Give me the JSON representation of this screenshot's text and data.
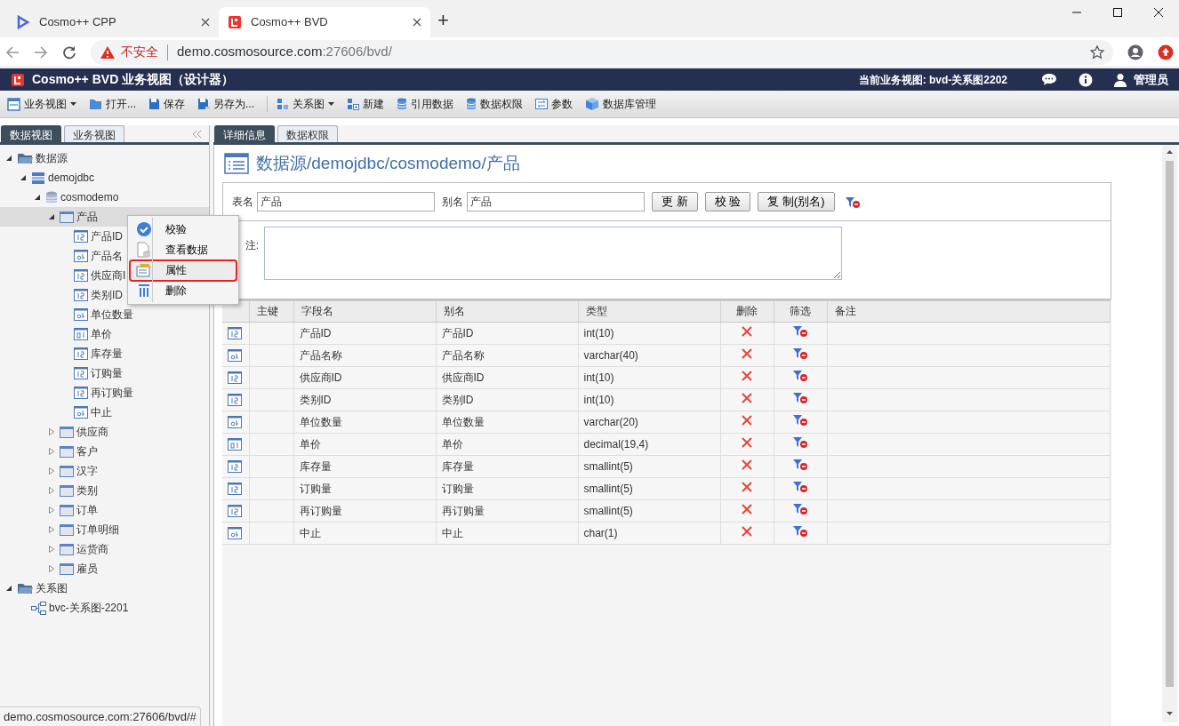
{
  "browser": {
    "tabs": [
      {
        "title": "Cosmo++ CPP",
        "kind": "cpp",
        "selected": false
      },
      {
        "title": "Cosmo++ BVD",
        "kind": "bvd",
        "selected": true
      }
    ],
    "new_tab": "+",
    "address": {
      "warning": "不安全",
      "host": "demo.cosmosource.com",
      "path": ":27606/bvd/"
    }
  },
  "app_header": {
    "title": "Cosmo++ BVD 业务视图（设计器）",
    "current_view": "当前业务视图: bvd-关系图2202",
    "user": "管理员"
  },
  "toolbar": [
    [
      {
        "label": "业务视图",
        "kind": "view",
        "dropdown": true
      },
      {
        "label": "打开...",
        "kind": "open",
        "dropdown": false
      },
      {
        "label": "保存",
        "kind": "save",
        "dropdown": false
      },
      {
        "label": "另存为...",
        "kind": "saveas",
        "dropdown": false
      }
    ],
    [
      {
        "label": "关系图",
        "kind": "diagram",
        "dropdown": true
      },
      {
        "label": "新建",
        "kind": "new",
        "dropdown": false
      },
      {
        "label": "引用数据",
        "kind": "database",
        "dropdown": false
      },
      {
        "label": "数据权限",
        "kind": "database",
        "dropdown": false
      },
      {
        "label": "参数",
        "kind": "params",
        "dropdown": false
      },
      {
        "label": "数据库管理",
        "kind": "cube",
        "dropdown": false
      }
    ]
  ],
  "left_panel": {
    "tabs": [
      {
        "label": "数据视图",
        "selected": true
      },
      {
        "label": "业务视图",
        "selected": false
      }
    ],
    "tree": [
      {
        "label": "数据源",
        "kind": "folder",
        "expanded": true,
        "selected": false,
        "children": [
          {
            "label": "demojdbc",
            "kind": "server",
            "expanded": true,
            "selected": false,
            "children": [
              {
                "label": "cosmodemo",
                "kind": "database",
                "expanded": true,
                "selected": false,
                "children": [
                  {
                    "label": "产品",
                    "kind": "table",
                    "expanded": true,
                    "selected": true,
                    "children": [
                      {
                        "label": "产品ID",
                        "kind": "field-int",
                        "selected": false
                      },
                      {
                        "label": "产品名",
                        "kind": "field-text",
                        "selected": false
                      },
                      {
                        "label": "供应商I",
                        "kind": "field-int",
                        "selected": false
                      },
                      {
                        "label": "类别ID",
                        "kind": "field-int",
                        "selected": false
                      },
                      {
                        "label": "单位数量",
                        "kind": "field-text",
                        "selected": false
                      },
                      {
                        "label": "单价",
                        "kind": "field-decimal",
                        "selected": false
                      },
                      {
                        "label": "库存量",
                        "kind": "field-int",
                        "selected": false
                      },
                      {
                        "label": "订购量",
                        "kind": "field-int",
                        "selected": false
                      },
                      {
                        "label": "再订购量",
                        "kind": "field-int",
                        "selected": false
                      },
                      {
                        "label": "中止",
                        "kind": "field-text",
                        "selected": false
                      }
                    ]
                  },
                  {
                    "label": "供应商",
                    "kind": "table",
                    "expanded": false,
                    "selected": false
                  },
                  {
                    "label": "客户",
                    "kind": "table",
                    "expanded": false,
                    "selected": false
                  },
                  {
                    "label": "汉字",
                    "kind": "table",
                    "expanded": false,
                    "selected": false
                  },
                  {
                    "label": "类别",
                    "kind": "table",
                    "expanded": false,
                    "selected": false
                  },
                  {
                    "label": "订单",
                    "kind": "table",
                    "expanded": false,
                    "selected": false
                  },
                  {
                    "label": "订单明细",
                    "kind": "table",
                    "expanded": false,
                    "selected": false
                  },
                  {
                    "label": "运货商",
                    "kind": "table",
                    "expanded": false,
                    "selected": false
                  },
                  {
                    "label": "雇员",
                    "kind": "table",
                    "expanded": false,
                    "selected": false
                  }
                ]
              }
            ]
          }
        ]
      },
      {
        "label": "关系图",
        "kind": "folder",
        "expanded": true,
        "selected": false,
        "children": [
          {
            "label": "bvc-关系图-2201",
            "kind": "diagram",
            "selected": false
          }
        ]
      }
    ]
  },
  "detail": {
    "tabs": [
      {
        "label": "详细信息",
        "selected": true
      },
      {
        "label": "数据权限",
        "selected": false
      }
    ],
    "heading": "数据源/demojdbc/cosmodemo/产品",
    "form": {
      "table_name_label": "表名",
      "table_name": "产品",
      "alias_label": "别名",
      "alias": "产品",
      "buttons": [
        "更 新",
        "校 验",
        "复 制(别名)"
      ],
      "remark_label": "注:"
    },
    "table": {
      "columns": [
        "主键",
        "字段名",
        "别名",
        "类型",
        "删除",
        "筛选",
        "备注"
      ],
      "rows": [
        {
          "kind": "int",
          "name": "产品ID",
          "alias": "产品ID",
          "type": "int(10)"
        },
        {
          "kind": "text",
          "name": "产品名称",
          "alias": "产品名称",
          "type": "varchar(40)"
        },
        {
          "kind": "int",
          "name": "供应商ID",
          "alias": "供应商ID",
          "type": "int(10)"
        },
        {
          "kind": "int",
          "name": "类别ID",
          "alias": "类别ID",
          "type": "int(10)"
        },
        {
          "kind": "text",
          "name": "单位数量",
          "alias": "单位数量",
          "type": "varchar(20)"
        },
        {
          "kind": "decimal",
          "name": "单价",
          "alias": "单价",
          "type": "decimal(19,4)"
        },
        {
          "kind": "int",
          "name": "库存量",
          "alias": "库存量",
          "type": "smallint(5)"
        },
        {
          "kind": "int",
          "name": "订购量",
          "alias": "订购量",
          "type": "smallint(5)"
        },
        {
          "kind": "int",
          "name": "再订购量",
          "alias": "再订购量",
          "type": "smallint(5)"
        },
        {
          "kind": "text",
          "name": "中止",
          "alias": "中止",
          "type": "char(1)"
        }
      ]
    }
  },
  "context_menu": {
    "items": [
      {
        "label": "校验",
        "kind": "check",
        "selected": false
      },
      {
        "label": "查看数据",
        "kind": "data",
        "selected": false
      },
      {
        "label": "属性",
        "kind": "properties",
        "selected": true
      },
      {
        "label": "删除",
        "kind": "trash",
        "selected": false
      }
    ]
  },
  "status_bar": "demo.cosmosource.com:27606/bvd/#"
}
